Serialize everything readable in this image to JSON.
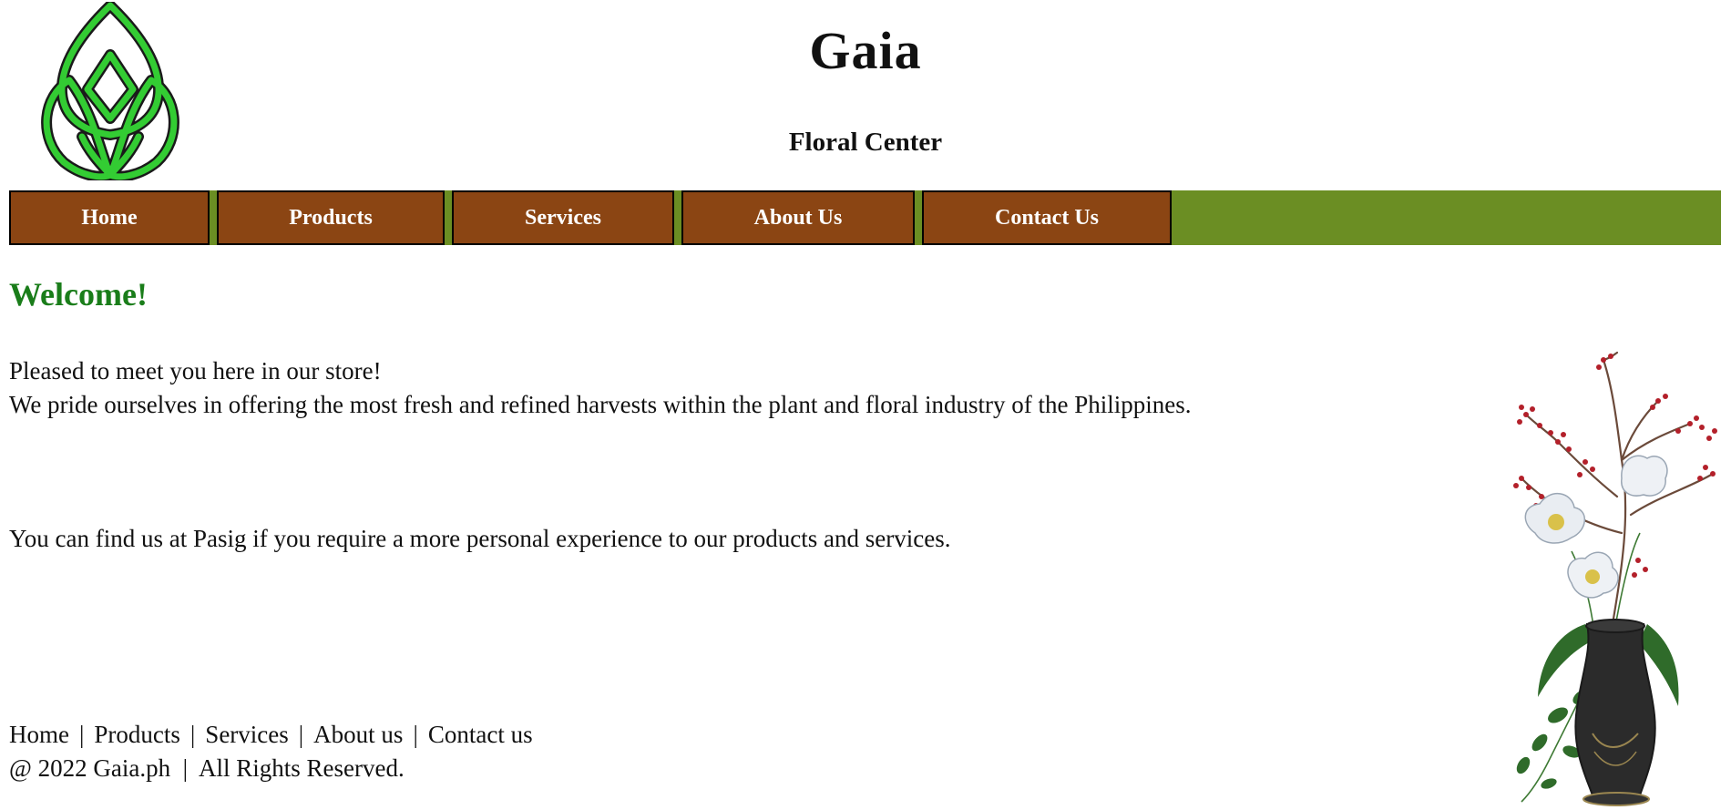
{
  "header": {
    "title": "Gaia",
    "subtitle": "Floral Center",
    "logo_icon": "lotus-leaf-logo-icon"
  },
  "nav": {
    "items": [
      "Home",
      "Products",
      "Services",
      "About Us",
      "Contact Us"
    ]
  },
  "main": {
    "heading": "Welcome!",
    "intro_line_1": "Pleased to meet you here in our store!",
    "intro_line_2": "We pride ourselves in offering the most fresh and refined harvests within the plant and floral industry of the Philippines.",
    "location_text": "You can find us at Pasig if you require a more personal experience to our products and services."
  },
  "footer": {
    "links": [
      "Home",
      "Products",
      "Services",
      "About us",
      "Contact us"
    ],
    "separator": "|",
    "copyright": "@ 2022 Gaia.ph  |  All Rights Reserved."
  },
  "decor": {
    "image_icon": "flower-vase-icon"
  },
  "colors": {
    "nav_bar": "#6b8e23",
    "nav_button": "#8b4513",
    "nav_border": "#000000",
    "heading": "#1a7d1a",
    "logo": "#33cc33"
  }
}
